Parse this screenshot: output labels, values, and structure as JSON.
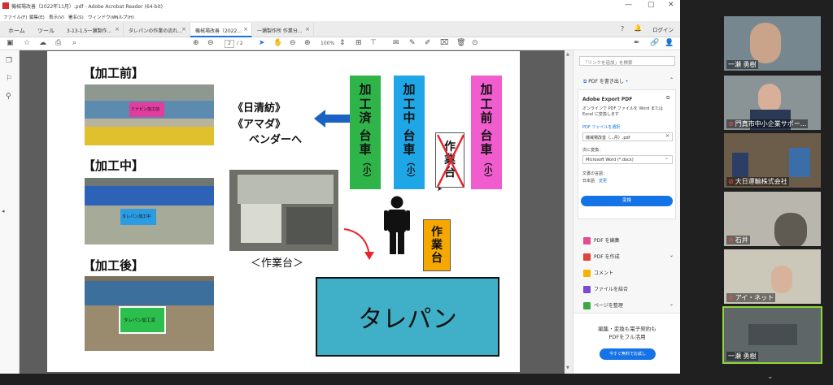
{
  "window": {
    "title": "機械場改善（2022年11月）.pdf - Adobe Acrobat Reader (64-bit)"
  },
  "menu": [
    "ファイル(F)",
    "編集(E)",
    "表示(V)",
    "署名(S)",
    "ウィンドウ(W)",
    "ヘルプ(H)"
  ],
  "tabs": [
    {
      "label": "ホーム"
    },
    {
      "label": "ツール"
    },
    {
      "label": "3-13-1.5一瀬製作..."
    },
    {
      "label": "タレパンの作業の流れ..."
    },
    {
      "label": "機械場改善（2022..."
    },
    {
      "label": "一瀬製作所 作業分..."
    }
  ],
  "header_right": {
    "help": "?",
    "bell": "🔔",
    "login": "ログイン"
  },
  "toolbar": {
    "page_current": "2",
    "page_total": "/ 2",
    "zoom": "100%"
  },
  "slide": {
    "before": "【加工前】",
    "during": "【加工中】",
    "after": "【加工後】",
    "vendor_1": "《日清紡》",
    "vendor_2": "《アマダ》",
    "vendor_3": "ベンダーへ",
    "cart_done": [
      "加",
      "工",
      "済",
      "台",
      "車",
      "（小）"
    ],
    "cart_doing": [
      "加",
      "工",
      "中",
      "台",
      "車",
      "（小）"
    ],
    "cart_before": [
      "加",
      "工",
      "前",
      "台",
      "車",
      "（小）"
    ],
    "crossed_table": [
      "作",
      "業",
      "台"
    ],
    "table": [
      "作",
      "業",
      "台"
    ],
    "workbench_caption": "＜作業台＞",
    "machine": "タレパン",
    "sign_1": "ミナピン加工前",
    "sign_2": "タレパン加工中",
    "sign_3": "タレパン加工済"
  },
  "right_panel": {
    "search_placeholder": "「リンクを追加」を検索",
    "export_heading": "PDF を書き出し",
    "export_title": "Adobe Export PDF",
    "export_desc": "オンラインで PDF ファイルを Word または Excel に変換します",
    "select_file": "PDF ファイルを選択",
    "file_name": "機械場改善（...月）.pdf",
    "convert_to": "次に変換：",
    "format": "Microsoft Word (*.docx)",
    "doc_lang": "文書の言語：",
    "lang": "日本語",
    "change": "変更",
    "convert_btn": "変換",
    "tools": [
      "PDF を編集",
      "PDF を作成",
      "コメント",
      "ファイルを結合",
      "ページを整理"
    ],
    "promo_1": "編集・変換も電子契約も",
    "promo_2": "PDFをフル活用",
    "trial_btn": "今すぐ無料でお試し"
  },
  "participants": [
    {
      "name": "一瀬 勇樹",
      "muted": false
    },
    {
      "name": "門真市中小企業サポー...",
      "muted": true
    },
    {
      "name": "大日運輸株式会社",
      "muted": true
    },
    {
      "name": "石井",
      "muted": true
    },
    {
      "name": "アイ・ネット",
      "muted": true
    },
    {
      "name": "一瀬 勇樹",
      "muted": false
    }
  ],
  "colors": {
    "accent": "#1473e6",
    "cart_done": "#2fb44a",
    "cart_doing": "#1fa6e6",
    "cart_before": "#f15ccf",
    "table": "#f7a800",
    "machine": "#3fb0c8",
    "arrow_blue": "#1a63c2",
    "arrow_red": "#e8252b"
  }
}
